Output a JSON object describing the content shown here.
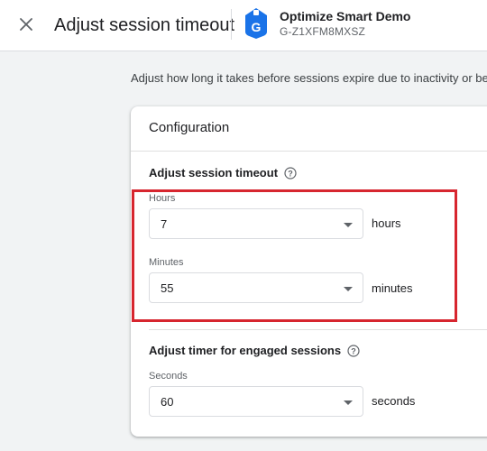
{
  "header": {
    "close_icon": "close-icon",
    "title": "Adjust session timeout",
    "property_icon": "google-tag-icon",
    "property_name": "Optimize Smart Demo",
    "property_id": "G-Z1XFM8MXSZ"
  },
  "intro_text": "Adjust how long it takes before sessions expire due to inactivity or bec",
  "configuration": {
    "card_title": "Configuration",
    "session_timeout": {
      "title": "Adjust session timeout",
      "help_icon": "help-icon",
      "hours": {
        "label": "Hours",
        "value": "7",
        "unit": "hours"
      },
      "minutes": {
        "label": "Minutes",
        "value": "55",
        "unit": "minutes"
      }
    },
    "engaged_sessions": {
      "title": "Adjust timer for engaged sessions",
      "help_icon": "help-icon",
      "seconds": {
        "label": "Seconds",
        "value": "60",
        "unit": "seconds"
      }
    }
  },
  "colors": {
    "highlight_border": "#d7262f",
    "tag_icon_blue": "#1a73e8"
  }
}
